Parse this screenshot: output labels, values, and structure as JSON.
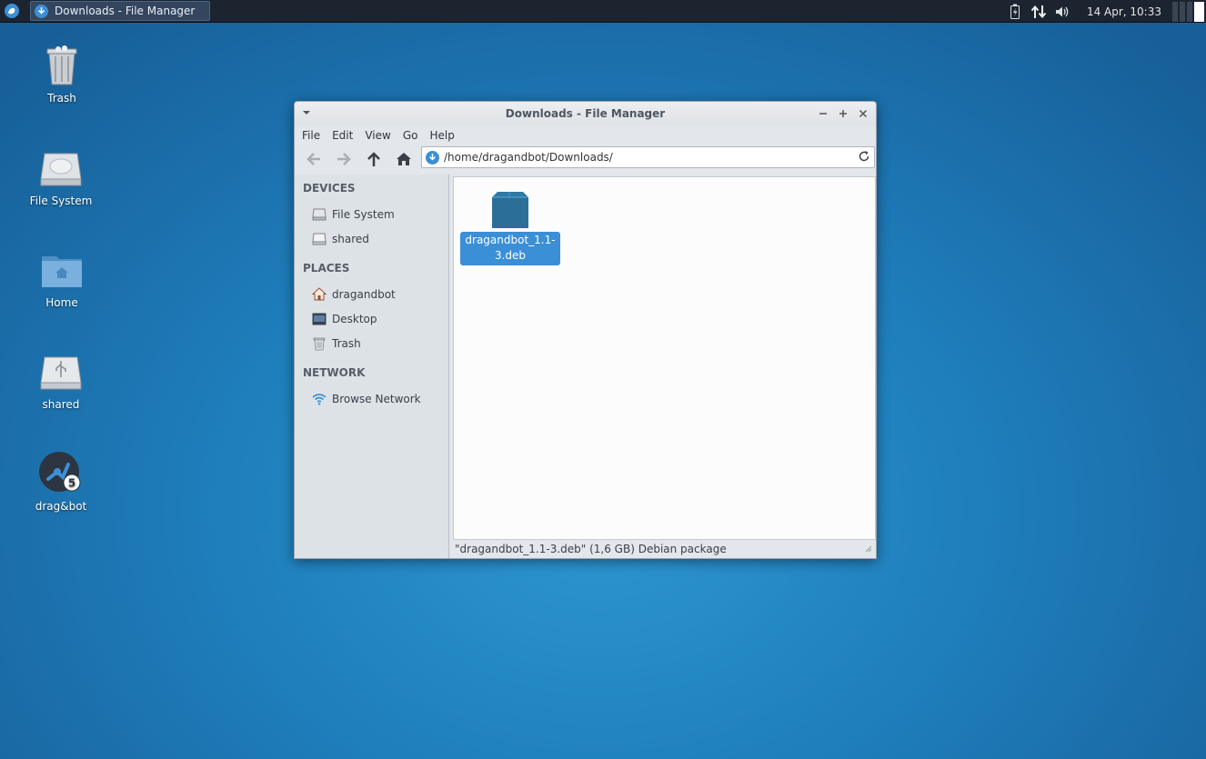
{
  "panel": {
    "task_label": "Downloads - File Manager",
    "clock": "14 Apr, 10:33",
    "tray_icons": [
      "battery-icon",
      "network-icon",
      "volume-icon"
    ]
  },
  "desktop": {
    "icons": [
      {
        "label": "Trash",
        "icon": "trash-icon"
      },
      {
        "label": "File System",
        "icon": "drive-icon"
      },
      {
        "label": "Home",
        "icon": "home-folder-icon"
      },
      {
        "label": "shared",
        "icon": "usb-drive-icon"
      },
      {
        "label": "drag&bot",
        "icon": "dragandbot-icon"
      }
    ]
  },
  "window": {
    "title": "Downloads - File Manager",
    "menu": [
      "File",
      "Edit",
      "View",
      "Go",
      "Help"
    ],
    "location": "/home/dragandbot/Downloads/",
    "sidebar": {
      "devices_header": "DEVICES",
      "devices": [
        "File System",
        "shared"
      ],
      "places_header": "PLACES",
      "places": [
        "dragandbot",
        "Desktop",
        "Trash"
      ],
      "network_header": "NETWORK",
      "network": [
        "Browse Network"
      ]
    },
    "files": [
      {
        "name": "dragandbot_1.1-3.deb",
        "icon": "package-icon",
        "selected": true
      }
    ],
    "status": "\"dragandbot_1.1-3.deb\" (1,6 GB) Debian package"
  },
  "colors": {
    "desktop_bg": "#1f7fbd",
    "selection": "#3b8fd6",
    "panel_bg": "#1c2430"
  }
}
